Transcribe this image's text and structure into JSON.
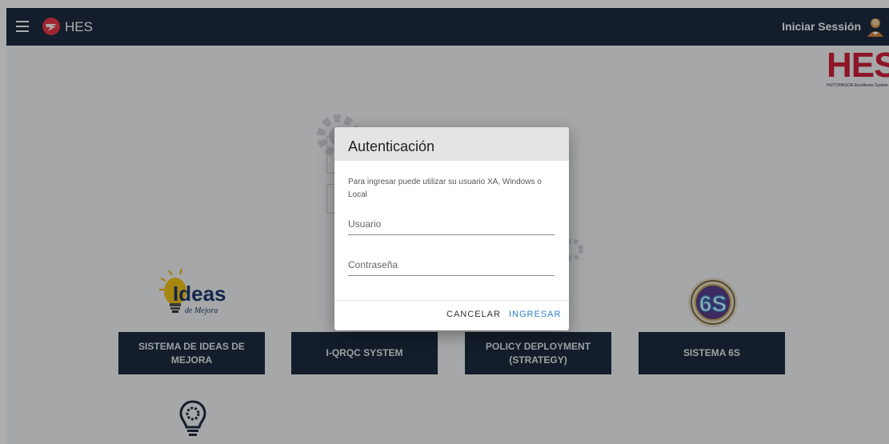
{
  "header": {
    "brand_name": "HES",
    "login_label": "Iniciar Sessión"
  },
  "hes_logo": {
    "text": "HES",
    "subtitle": "HUTCHINSON Excellence System"
  },
  "tiles": [
    {
      "label": "SISTEMA DE IDEAS DE MEJORA",
      "logo_text": "Ideas",
      "logo_sub": "de Mejora"
    },
    {
      "label": "I-QRQC SYSTEM"
    },
    {
      "label": "POLICY DEPLOYMENT (STRATEGY)"
    },
    {
      "label": "SISTEMA 6S",
      "logo_text": "6S"
    }
  ],
  "dialog": {
    "title": "Autenticación",
    "description": "Para ingresar puede utilizar su usuario XA, Windows o Local",
    "username_placeholder": "Usuario",
    "password_placeholder": "Contraseña",
    "cancel_label": "CANCELAR",
    "submit_label": "INGRESAR"
  },
  "colors": {
    "navbar": "#1c2b40",
    "tile": "#1c2b40",
    "brand_red": "#cf1f3a",
    "accent_blue": "#2f80c9"
  }
}
